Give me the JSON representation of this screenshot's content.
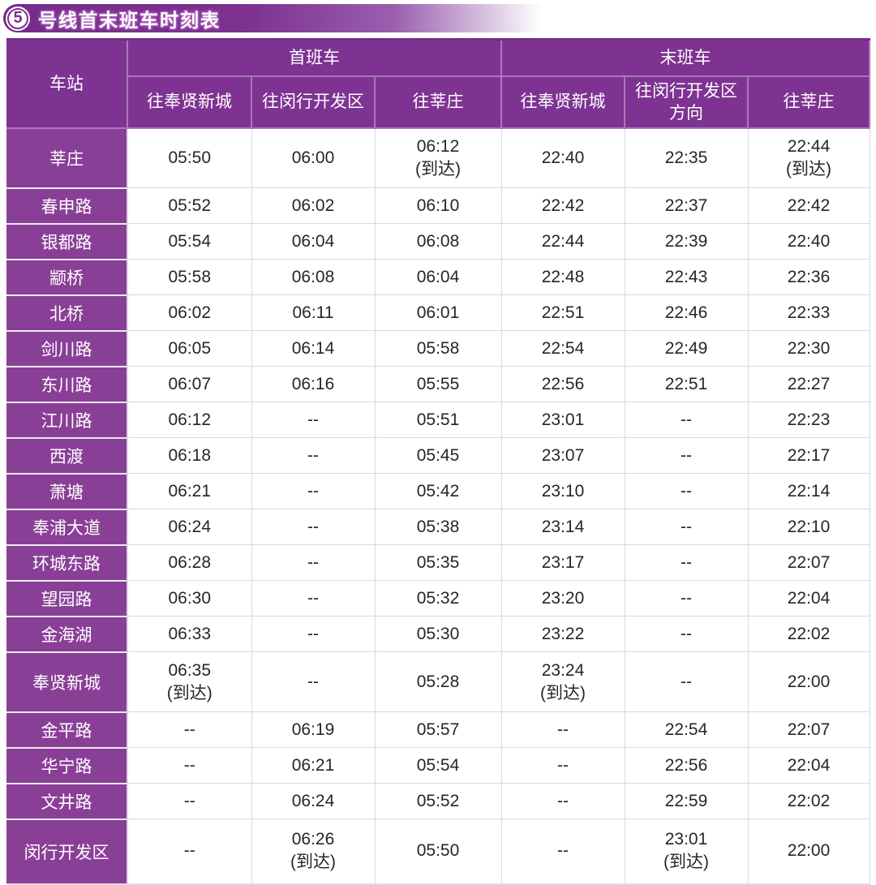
{
  "header": {
    "line_number": "5",
    "title": "号线首末班车时刻表"
  },
  "colors": {
    "brand_purple_dark": "#762b89",
    "table_header_purple": "#7e3392",
    "station_cell_purple": "#8a3f97",
    "time_text": "#262626",
    "grid_line": "#d9d9d9"
  },
  "table": {
    "station_header": "车站",
    "groups": [
      {
        "label": "首班车",
        "columns": [
          "往奉贤新城",
          "往闵行开发区",
          "往莘庄"
        ]
      },
      {
        "label": "末班车",
        "columns": [
          "往奉贤新城",
          "往闵行开发区方向",
          "往莘庄"
        ]
      }
    ],
    "rows": [
      {
        "station": "莘庄",
        "times": [
          "05:50",
          "06:00",
          "06:12\n(到达)",
          "22:40",
          "22:35",
          "22:44\n(到达)"
        ]
      },
      {
        "station": "春申路",
        "times": [
          "05:52",
          "06:02",
          "06:10",
          "22:42",
          "22:37",
          "22:42"
        ]
      },
      {
        "station": "银都路",
        "times": [
          "05:54",
          "06:04",
          "06:08",
          "22:44",
          "22:39",
          "22:40"
        ]
      },
      {
        "station": "颛桥",
        "times": [
          "05:58",
          "06:08",
          "06:04",
          "22:48",
          "22:43",
          "22:36"
        ]
      },
      {
        "station": "北桥",
        "times": [
          "06:02",
          "06:11",
          "06:01",
          "22:51",
          "22:46",
          "22:33"
        ]
      },
      {
        "station": "剑川路",
        "times": [
          "06:05",
          "06:14",
          "05:58",
          "22:54",
          "22:49",
          "22:30"
        ]
      },
      {
        "station": "东川路",
        "times": [
          "06:07",
          "06:16",
          "05:55",
          "22:56",
          "22:51",
          "22:27"
        ]
      },
      {
        "station": "江川路",
        "times": [
          "06:12",
          "--",
          "05:51",
          "23:01",
          "--",
          "22:23"
        ]
      },
      {
        "station": "西渡",
        "times": [
          "06:18",
          "--",
          "05:45",
          "23:07",
          "--",
          "22:17"
        ]
      },
      {
        "station": "萧塘",
        "times": [
          "06:21",
          "--",
          "05:42",
          "23:10",
          "--",
          "22:14"
        ]
      },
      {
        "station": "奉浦大道",
        "times": [
          "06:24",
          "--",
          "05:38",
          "23:14",
          "--",
          "22:10"
        ]
      },
      {
        "station": "环城东路",
        "times": [
          "06:28",
          "--",
          "05:35",
          "23:17",
          "--",
          "22:07"
        ]
      },
      {
        "station": "望园路",
        "times": [
          "06:30",
          "--",
          "05:32",
          "23:20",
          "--",
          "22:04"
        ]
      },
      {
        "station": "金海湖",
        "times": [
          "06:33",
          "--",
          "05:30",
          "23:22",
          "--",
          "22:02"
        ]
      },
      {
        "station": "奉贤新城",
        "times": [
          "06:35\n(到达)",
          "--",
          "05:28",
          "23:24\n(到达)",
          "--",
          "22:00"
        ]
      },
      {
        "station": "金平路",
        "times": [
          "--",
          "06:19",
          "05:57",
          "--",
          "22:54",
          "22:07"
        ]
      },
      {
        "station": "华宁路",
        "times": [
          "--",
          "06:21",
          "05:54",
          "--",
          "22:56",
          "22:04"
        ]
      },
      {
        "station": "文井路",
        "times": [
          "--",
          "06:24",
          "05:52",
          "--",
          "22:59",
          "22:02"
        ]
      },
      {
        "station": "闵行开发区",
        "times": [
          "--",
          "06:26\n(到达)",
          "05:50",
          "--",
          "23:01\n(到达)",
          "22:00"
        ]
      }
    ]
  }
}
